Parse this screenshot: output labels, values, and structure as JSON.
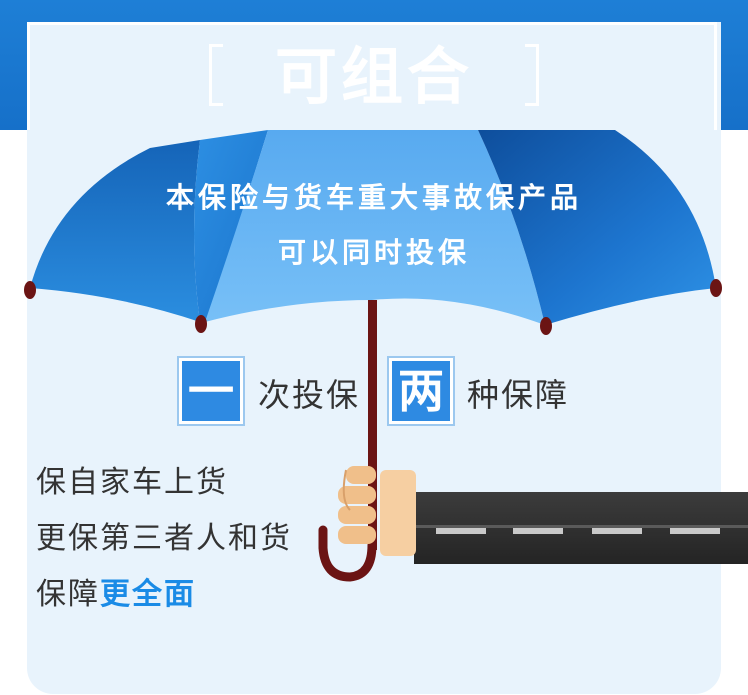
{
  "header": {
    "title": "可组合"
  },
  "umbrella": {
    "line1": "本保险与货车重大事故保产品",
    "line2": "可以同时投保"
  },
  "features": [
    {
      "char": "一",
      "text": "次投保"
    },
    {
      "char": "两",
      "text": "种保障"
    }
  ],
  "description": {
    "line1": "保自家车上货",
    "line2": "更保第三者人和货",
    "line3_plain": "保障",
    "line3_highlight": "更全面"
  },
  "colors": {
    "header_blue": "#1e7fd6",
    "card_background": "#e8f3fc",
    "umbrella_dark": "#1a6fc4",
    "umbrella_light": "#6bb8f2",
    "handle": "#6b1414",
    "highlight": "#1a8be6"
  },
  "icons": [
    "umbrella-icon",
    "hand-icon",
    "road-icon"
  ]
}
